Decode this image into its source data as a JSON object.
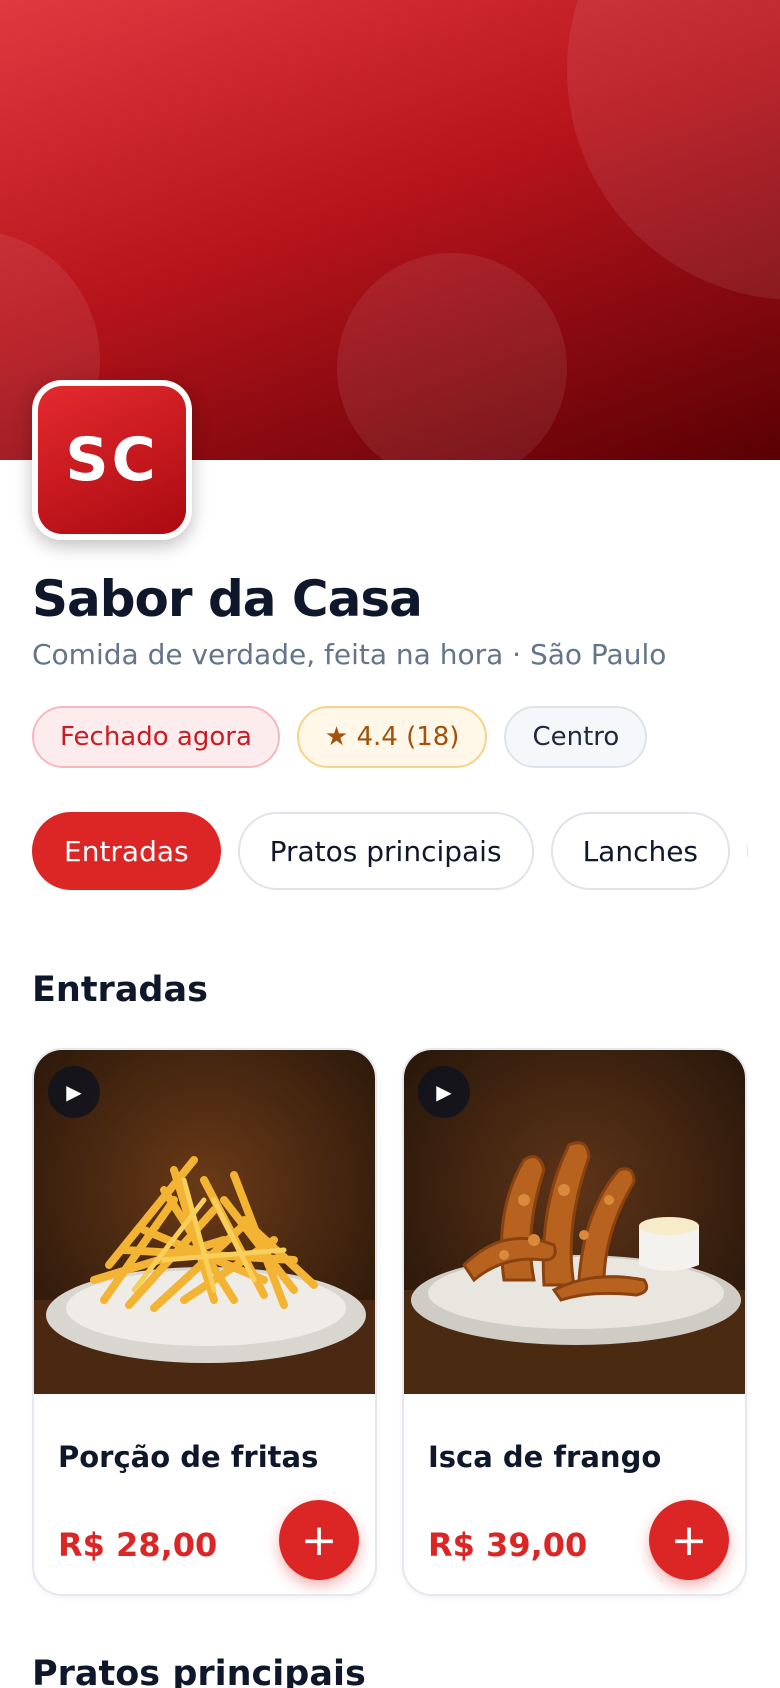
{
  "restaurant": {
    "logo_initials": "SC",
    "name": "Sabor da Casa",
    "tagline": "Comida de verdade, feita na hora · São Paulo"
  },
  "badges": {
    "status": "Fechado agora",
    "rating": "★ 4.4 (18)",
    "neighborhood": "Centro"
  },
  "category_tabs": [
    {
      "label": "Entradas",
      "active": true
    },
    {
      "label": "Pratos principais",
      "active": false
    },
    {
      "label": "Lanches",
      "active": false
    },
    {
      "label": "",
      "active": false
    }
  ],
  "sections": [
    {
      "title": "Entradas",
      "items": [
        {
          "name": "Porção de fritas",
          "price": "R$ 28,00",
          "play_icon": "▶",
          "add_icon": "+",
          "photo": "fries-plate-photo"
        },
        {
          "name": "Isca de frango",
          "price": "R$ 39,00",
          "play_icon": "▶",
          "add_icon": "+",
          "photo": "chicken-strips-photo"
        }
      ]
    },
    {
      "title": "Pratos principais",
      "items": []
    }
  ],
  "colors": {
    "brand": "#dc2626",
    "hero_top": "#e03a40",
    "hero_bottom": "#5a0004",
    "text_primary": "#0f172a",
    "text_muted": "#64748b"
  }
}
